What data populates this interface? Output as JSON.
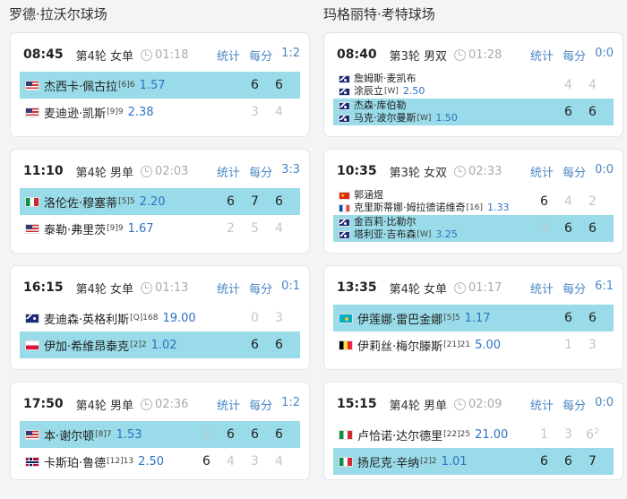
{
  "courts": [
    {
      "title": "罗德·拉沃尔球场"
    },
    {
      "title": "玛格丽特·考特球场"
    }
  ],
  "links": {
    "stats": "统计",
    "points": "每分"
  },
  "matches": [
    {
      "time": "08:45",
      "round": "第4轮 女单",
      "duration": "01:18",
      "score": "1:2",
      "p1": {
        "flag": "us",
        "name": "杰西卡·佩古拉",
        "seed": "[6]6",
        "odds": "1.57",
        "sets": [
          "6",
          "6"
        ],
        "win": true
      },
      "p2": {
        "flag": "us",
        "name": "麦迪逊·凯斯",
        "seed": "[9]9",
        "odds": "2.38",
        "sets": [
          "3",
          "4"
        ],
        "win": false
      }
    },
    {
      "time": "11:10",
      "round": "第4轮 男单",
      "duration": "02:03",
      "score": "3:3",
      "p1": {
        "flag": "it",
        "name": "洛伦佐·穆塞蒂",
        "seed": "[5]5",
        "odds": "2.20",
        "sets": [
          "6",
          "7",
          "6"
        ],
        "win": true
      },
      "p2": {
        "flag": "us",
        "name": "泰勒·弗里茨",
        "seed": "[9]9",
        "odds": "1.67",
        "sets": [
          "2",
          "5",
          "4"
        ],
        "win": false
      }
    },
    {
      "time": "16:15",
      "round": "第4轮 女单",
      "duration": "01:13",
      "score": "0:1",
      "p1": {
        "flag": "au",
        "name": "麦迪森·英格利斯",
        "seed": "[Q]168",
        "odds": "19.00",
        "sets": [
          "0",
          "3"
        ],
        "win": false
      },
      "p2": {
        "flag": "pl",
        "name": "伊加·希维昂泰克",
        "seed": "[2]2",
        "odds": "1.02",
        "sets": [
          "6",
          "6"
        ],
        "win": true
      }
    },
    {
      "time": "17:50",
      "round": "第4轮 男单",
      "duration": "02:36",
      "score": "1:2",
      "p1": {
        "flag": "us",
        "name": "本·谢尔顿",
        "seed": "[8]7",
        "odds": "1.53",
        "sets": [
          "3",
          "6",
          "6",
          "6"
        ],
        "win": true
      },
      "p2": {
        "flag": "no",
        "name": "卡斯珀·鲁德",
        "seed": "[12]13",
        "odds": "2.50",
        "sets": [
          "6",
          "4",
          "3",
          "4"
        ],
        "win": false
      }
    },
    {
      "time": "08:40",
      "round": "第3轮 男双",
      "duration": "01:28",
      "score": "0:0",
      "p1": {
        "players": [
          {
            "flag": "au",
            "name": "詹姆斯·麦凯布"
          },
          {
            "flag": "au",
            "name": "涂辰立"
          }
        ],
        "seed": "[W]",
        "odds": "2.50",
        "sets": [
          "4",
          "4"
        ],
        "win": false
      },
      "p2": {
        "players": [
          {
            "flag": "au",
            "name": "杰森·库伯勒"
          },
          {
            "flag": "au",
            "name": "马克·波尔曼斯"
          }
        ],
        "seed": "[W]",
        "odds": "1.50",
        "sets": [
          "6",
          "6"
        ],
        "win": true
      }
    },
    {
      "time": "10:35",
      "round": "第3轮 女双",
      "duration": "02:33",
      "score": "0:0",
      "p1": {
        "players": [
          {
            "flag": "cn",
            "name": "郭涵煜"
          },
          {
            "flag": "fr",
            "name": "克里斯蒂娜·姆拉德诺维奇"
          }
        ],
        "seed": "[16]",
        "odds": "1.33",
        "sets": [
          "6",
          "4",
          "2"
        ],
        "win": false
      },
      "p2": {
        "players": [
          {
            "flag": "au",
            "name": "金百莉·比勒尔"
          },
          {
            "flag": "au",
            "name": "塔利亚·吉布森"
          }
        ],
        "seed": "[W]",
        "odds": "3.25",
        "sets": [
          "3",
          "6",
          "6"
        ],
        "win": true
      }
    },
    {
      "time": "13:35",
      "round": "第4轮 女单",
      "duration": "01:17",
      "score": "6:1",
      "p1": {
        "flag": "kz",
        "name": "伊莲娜·雷巴金娜",
        "seed": "[5]5",
        "odds": "1.17",
        "sets": [
          "6",
          "6"
        ],
        "win": true
      },
      "p2": {
        "flag": "be",
        "name": "伊莉丝·梅尔滕斯",
        "seed": "[21]21",
        "odds": "5.00",
        "sets": [
          "1",
          "3"
        ],
        "win": false
      }
    },
    {
      "time": "15:15",
      "round": "第4轮 男单",
      "duration": "02:09",
      "score": "0:0",
      "p1": {
        "flag": "it",
        "name": "卢恰诺·达尔德里",
        "seed": "[22]25",
        "odds": "21.00",
        "sets": [
          "1",
          "3",
          "6"
        ],
        "tb": "2",
        "win": false
      },
      "p2": {
        "flag": "it",
        "name": "扬尼克·辛纳",
        "seed": "[2]2",
        "odds": "1.01",
        "sets": [
          "6",
          "6",
          "7"
        ],
        "win": true
      }
    }
  ]
}
